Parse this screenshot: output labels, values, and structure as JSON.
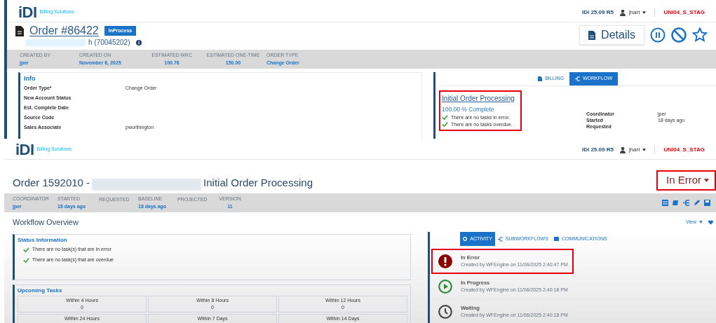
{
  "order_page": {
    "header": {
      "logo": "iDI",
      "logo_tagline": "Billing Solutions",
      "version": "IDI 25.09 R5",
      "user": "jhart",
      "environment": "UNI04_S_STAG"
    },
    "order": {
      "title": "Order #86422",
      "badge": "InProcess",
      "account": "h (70045202)"
    },
    "details_button": "Details",
    "stats": [
      {
        "label": "CREATED BY",
        "value": "jper"
      },
      {
        "label": "CREATED ON",
        "value": "November 6, 2025"
      },
      {
        "label": "ESTIMATED MRC",
        "value": "100.76"
      },
      {
        "label": "ESTIMATED ONE-TIME",
        "value": "150.00"
      },
      {
        "label": "ORDER TYPE",
        "value": "Change Order"
      }
    ],
    "info": {
      "title": "Info",
      "fields": [
        {
          "label": "Order Type*",
          "value": "Change Order"
        },
        {
          "label": "New Account Status"
        },
        {
          "label": "Est. Complete Date"
        },
        {
          "label": "Source Code"
        },
        {
          "label": "Sales Associate",
          "value": "pworthington"
        }
      ]
    },
    "tabs": [
      {
        "label": "BILLING",
        "selected": false
      },
      {
        "label": "WORKFLOW",
        "selected": true
      }
    ],
    "workflow": {
      "name": "Initial Order Processing",
      "progress": "100.00 % Complete",
      "checks": [
        "There are no tasks in error.",
        "There are no tasks overdue."
      ],
      "details": [
        {
          "label": "Coordinator",
          "value": "jper"
        },
        {
          "label": "Started",
          "value": "18 days ago"
        },
        {
          "label": "Requested"
        }
      ]
    }
  },
  "workflow_page": {
    "header": {
      "logo": "iDI",
      "logo_tagline": "Billing Solutions",
      "version": "IDI 25.09 R5",
      "user": "jhart",
      "environment": "UNI04_S_STAG"
    },
    "title_prefix": "Order 1592010 -",
    "title_suffix": "Initial Order Processing",
    "status": "In Error",
    "stats": [
      {
        "label": "COORDINATOR",
        "value": "jper"
      },
      {
        "label": "STARTED",
        "value": "18 days ago"
      },
      {
        "label": "REQUESTED"
      },
      {
        "label": "BASELINE",
        "value": "18 days ago"
      },
      {
        "label": "PROJECTED"
      },
      {
        "label": "VERSION",
        "value": "11"
      }
    ],
    "section_title": "Workflow Overview",
    "view_menu": "View",
    "status_info": {
      "title": "Status Information",
      "items": [
        "There are no task(s) that are in error",
        "There are no task(s) that are overdue"
      ]
    },
    "upcoming": {
      "title": "Upcoming Tasks",
      "cells": [
        {
          "label": "Within 4 Hours",
          "count": "0"
        },
        {
          "label": "Within 8 Hours",
          "count": "0"
        },
        {
          "label": "Within 12 Hours",
          "count": "0"
        },
        {
          "label": "Within 24 Hours"
        },
        {
          "label": "Within 7 Days"
        },
        {
          "label": "Within 14 Days"
        }
      ]
    },
    "tabs": [
      {
        "label": "ACTIVITY",
        "selected": true
      },
      {
        "label": "SUBWORKFLOWS",
        "selected": false
      },
      {
        "label": "COMMUNICATIONS",
        "selected": false
      }
    ],
    "activity": [
      {
        "kind": "error",
        "title": "In Error",
        "meta": "Created by WFEngine on 11/06/2025 2:40:47 PM",
        "highlighted": true
      },
      {
        "kind": "progress",
        "title": "In Progress",
        "meta": "Created by WFEngine on 11/06/2025 2:40:18 PM",
        "highlighted": false
      },
      {
        "kind": "waiting",
        "title": "Waiting",
        "meta": "Created by WFEngine on 11/06/2025 2:40:18 PM",
        "highlighted": false
      }
    ]
  }
}
